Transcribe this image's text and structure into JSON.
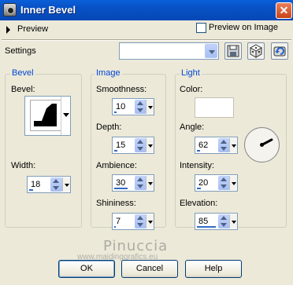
{
  "title": "Inner Bevel",
  "close_glyph": "✕",
  "preview_label": "Preview",
  "preview_on_image_label": "Preview on Image",
  "preview_on_image_checked": false,
  "settings_label": "Settings",
  "settings_value": "",
  "groups": {
    "bevel": {
      "title": "Bevel",
      "bevel_label": "Bevel:",
      "width": {
        "label": "Width:",
        "value": "18",
        "level": 0.18
      }
    },
    "image": {
      "title": "Image",
      "smoothness": {
        "label": "Smoothness:",
        "value": "10",
        "level": 0.1
      },
      "depth": {
        "label": "Depth:",
        "value": "15",
        "level": 0.15
      },
      "ambience": {
        "label": "Ambience:",
        "value": "30",
        "level": 0.65
      },
      "shininess": {
        "label": "Shininess:",
        "value": "7",
        "level": 0.07
      }
    },
    "light": {
      "title": "Light",
      "color_label": "Color:",
      "color_value": "#ffffff",
      "angle": {
        "label": "Angle:",
        "value": "62",
        "level": 0.17
      },
      "intensity": {
        "label": "Intensity:",
        "value": "20",
        "level": 0.2
      },
      "elevation": {
        "label": "Elevation:",
        "value": "85",
        "level": 0.94
      }
    }
  },
  "buttons": {
    "ok": "OK",
    "cancel": "Cancel",
    "help": "Help"
  },
  "watermark": {
    "name": "Pinuccia",
    "site": "www.maidinggrafics.eu"
  },
  "colors": {
    "titlebar": "#0a5fd8",
    "group_title": "#0046d5",
    "dialog_bg": "#ece9d8",
    "value_bar": "#316ac5"
  }
}
